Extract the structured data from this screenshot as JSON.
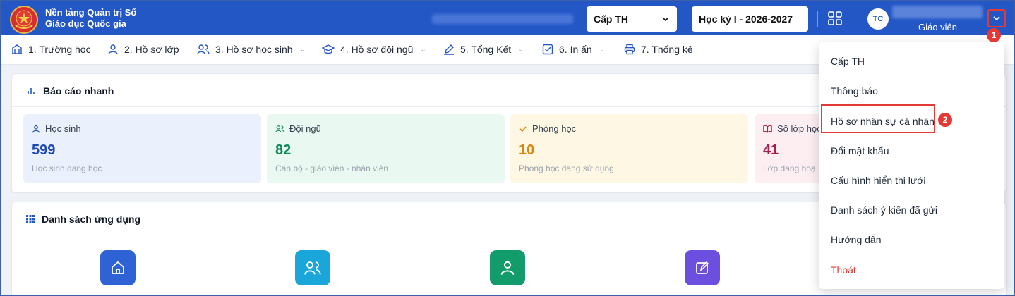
{
  "header": {
    "brand_line1": "Nền tảng Quản trị Số",
    "brand_line2": "Giáo dục Quốc gia",
    "level_select": "Cấp TH",
    "term_select": "Học kỳ I - 2026-2027",
    "avatar_initials": "TC",
    "user_role": "Giáo viên"
  },
  "menu": [
    {
      "label": "1. Trường học",
      "icon": "school-icon"
    },
    {
      "label": "2. Hồ sơ lớp",
      "icon": "user-icon"
    },
    {
      "label": "3. Hồ sơ học sinh",
      "icon": "users-icon"
    },
    {
      "label": "4. Hồ sơ đội ngũ",
      "icon": "graduation-cap-icon"
    },
    {
      "label": "5. Tổng Kết",
      "icon": "pen-icon"
    },
    {
      "label": "6. In ấn",
      "icon": "checkbox-icon"
    },
    {
      "label": "7. Thống kê",
      "icon": "printer-icon"
    }
  ],
  "quick_report": {
    "title": "Báo cáo nhanh",
    "stats": [
      {
        "label": "Học sinh",
        "value": "599",
        "sub": "Học sinh đang học",
        "color": "#1e49b8"
      },
      {
        "label": "Đội ngũ",
        "value": "82",
        "sub": "Cán bộ - giáo viên - nhân viên",
        "color": "#0f8a57"
      },
      {
        "label": "Phòng học",
        "value": "10",
        "sub": "Phòng học đang sử dụng",
        "color": "#d9860b"
      },
      {
        "label": "Số lớp học",
        "value": "41",
        "sub": "Lớp đang hoạ",
        "color": "#a8204a"
      }
    ]
  },
  "apps": {
    "title": "Danh sách ứng dụng",
    "tiles": [
      {
        "icon": "home-icon",
        "color": "#2f62d4"
      },
      {
        "icon": "users-icon",
        "color": "#1aa6d9"
      },
      {
        "icon": "user-icon",
        "color": "#129b6b"
      },
      {
        "icon": "edit-icon",
        "color": "#6d4fe0"
      }
    ]
  },
  "user_menu": {
    "items": [
      "Cấp TH",
      "Thông báo",
      "Hồ sơ nhân sự cá nhân",
      "Đổi mật khẩu",
      "Cấu hình hiển thị lưới",
      "Danh sách ý kiến đã gửi",
      "Hướng dẫn",
      "Thoát"
    ],
    "logout_color": "#e53935"
  },
  "callouts": {
    "step1": "1",
    "step2": "2"
  }
}
